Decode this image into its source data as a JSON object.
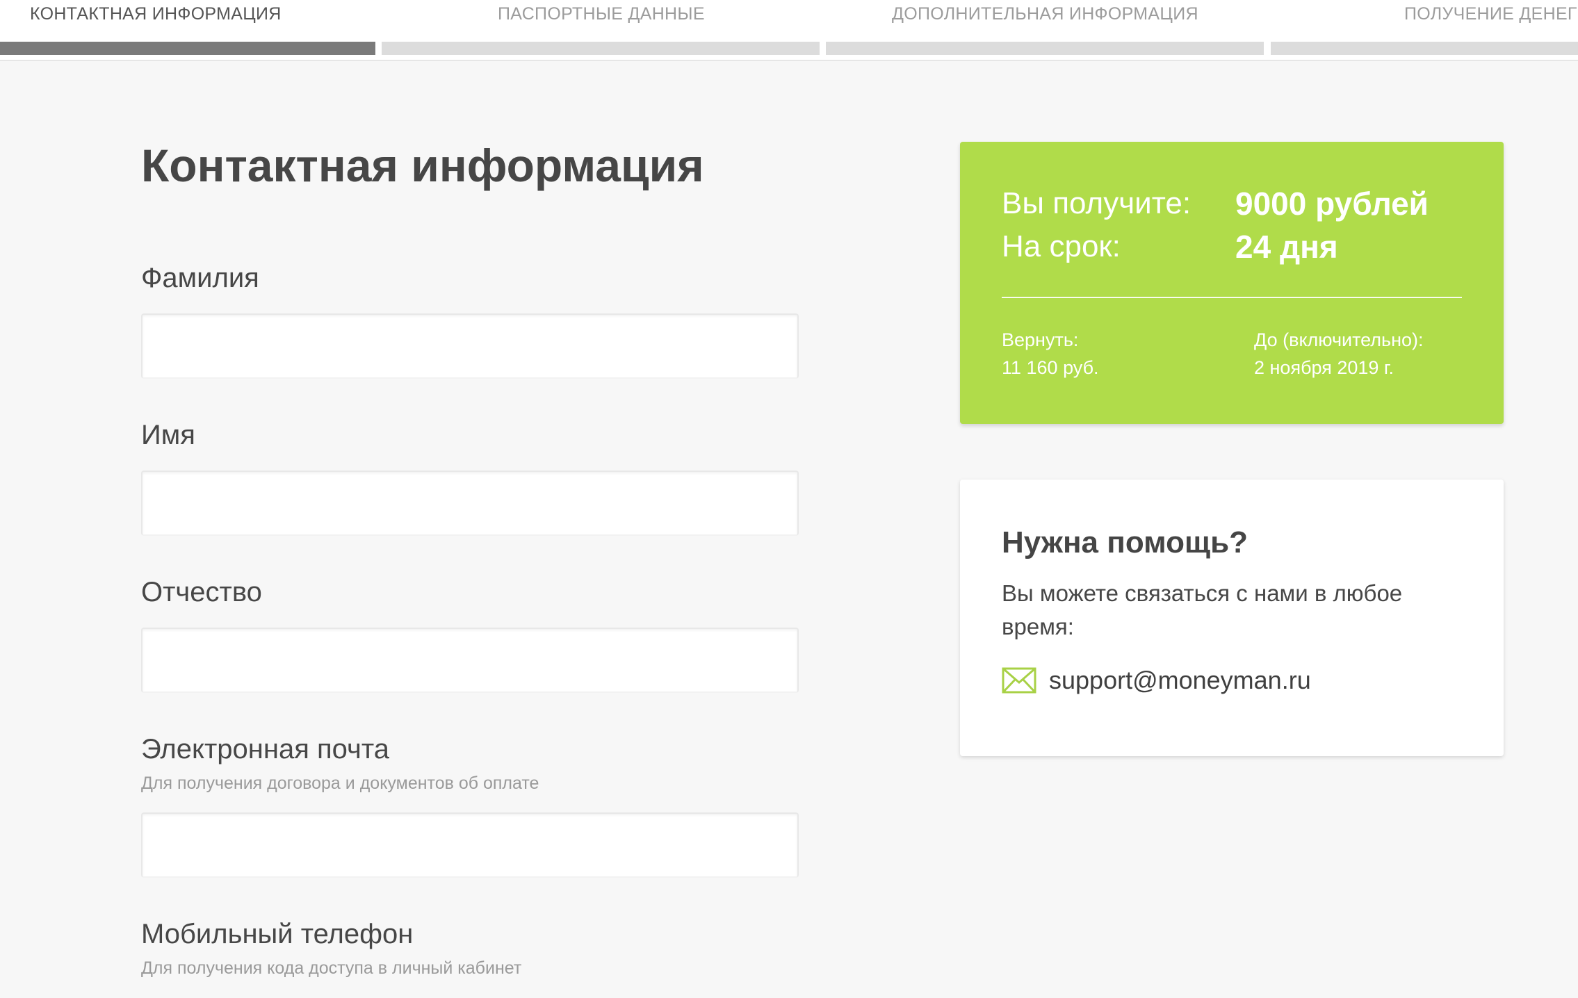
{
  "stepper": {
    "steps": [
      {
        "label": "КОНТАКТНАЯ ИНФОРМАЦИЯ",
        "active": true
      },
      {
        "label": "ПАСПОРТНЫЕ ДАННЫЕ",
        "active": false
      },
      {
        "label": "ДОПОЛНИТЕЛЬНАЯ ИНФОРМАЦИЯ",
        "active": false
      },
      {
        "label": "ПОЛУЧЕНИЕ ДЕНЕГ",
        "active": false
      }
    ]
  },
  "form": {
    "title": "Контактная информация",
    "fields": [
      {
        "label": "Фамилия",
        "hint": "",
        "value": "",
        "placeholder": ""
      },
      {
        "label": "Имя",
        "hint": "",
        "value": "",
        "placeholder": ""
      },
      {
        "label": "Отчество",
        "hint": "",
        "value": "",
        "placeholder": ""
      },
      {
        "label": "Электронная почта",
        "hint": "Для получения договора и документов об оплате",
        "value": "",
        "placeholder": ""
      },
      {
        "label": "Мобильный телефон",
        "hint": "Для получения кода доступа в личный кабинет",
        "value": "",
        "placeholder": ""
      }
    ]
  },
  "summary": {
    "receive_label": "Вы получите:",
    "receive_value": "9000 рублей",
    "term_label": "На срок:",
    "term_value": "24 дня",
    "return_label": "Вернуть:",
    "return_value": "11 160 руб.",
    "until_label": "До (включительно):",
    "until_value": "2 ноября 2019 г."
  },
  "help": {
    "title": "Нужна помощь?",
    "text": "Вы можете связаться с нами в любое время:",
    "email": "support@moneyman.ru",
    "icon": "mail-icon"
  },
  "colors": {
    "accent_green": "#b0dc4a",
    "step_active": "#7a7a7a",
    "step_inactive": "#dcdcdc",
    "background": "#f7f7f7"
  }
}
